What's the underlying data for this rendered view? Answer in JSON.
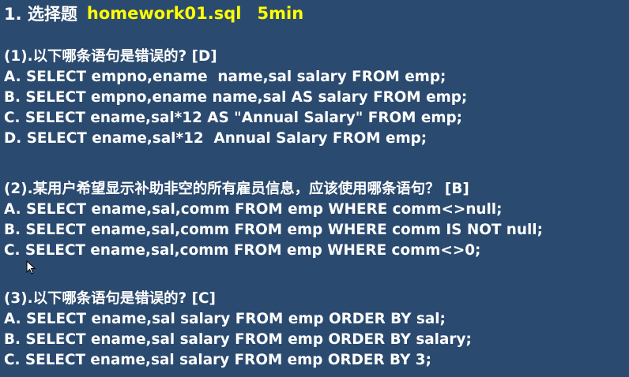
{
  "header": {
    "number_label": "1. 选择题",
    "file": "homework01.sql",
    "time": "5min"
  },
  "questions": [
    {
      "title": "(1).以下哪条语句是错误的? [D]",
      "options": [
        "A. SELECT empno,ename  name,sal salary FROM emp;",
        "B. SELECT empno,ename name,sal AS salary FROM emp;",
        "C. SELECT ename,sal*12 AS \"Annual Salary\" FROM emp;",
        "D. SELECT ename,sal*12  Annual Salary FROM emp;"
      ]
    },
    {
      "title": "(2).某用户希望显示补助非空的所有雇员信息，应该使用哪条语句？ [B]",
      "options": [
        "A. SELECT ename,sal,comm FROM emp WHERE comm<>null;",
        "B. SELECT ename,sal,comm FROM emp WHERE comm IS NOT null;",
        "C. SELECT ename,sal,comm FROM emp WHERE comm<>0;"
      ]
    },
    {
      "title": "(3).以下哪条语句是错误的? [C]",
      "options": [
        "A. SELECT ename,sal salary FROM emp ORDER BY sal;",
        "B. SELECT ename,sal salary FROM emp ORDER BY salary;",
        "C. SELECT ename,sal salary FROM emp ORDER BY 3;"
      ]
    }
  ]
}
